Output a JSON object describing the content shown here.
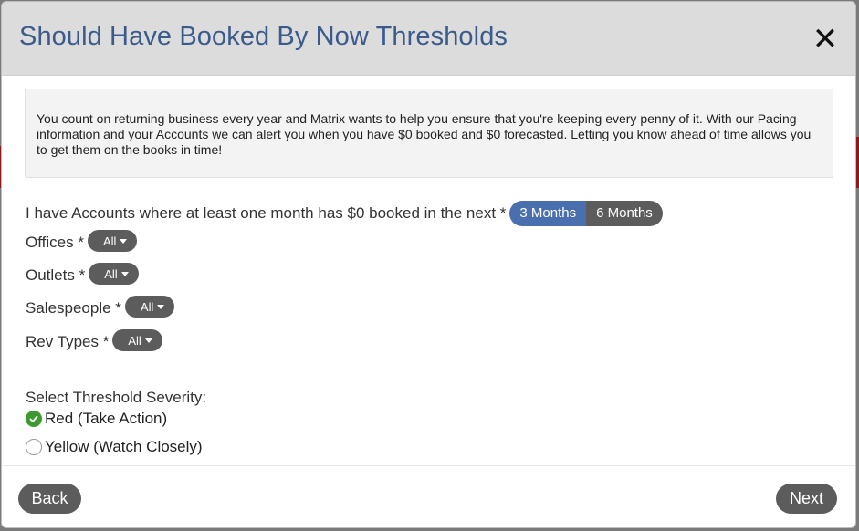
{
  "modal": {
    "title": "Should Have Booked By Now Thresholds",
    "close_label": "✕"
  },
  "info": {
    "text": "You count on returning business every year and Matrix wants to help you ensure that you're keeping every penny of it. With our Pacing information and your Accounts we can alert you when you have $0 booked and $0 forecasted. Letting you know ahead of time allows you to get them on the books in time!"
  },
  "months": {
    "label": "I have Accounts where at least one month has $0 booked in the next *",
    "options": [
      "3 Months",
      "6 Months"
    ],
    "selected": "3 Months"
  },
  "filters": {
    "offices": {
      "label": "Offices *",
      "value": "All"
    },
    "outlets": {
      "label": "Outlets *",
      "value": "All"
    },
    "salespeople": {
      "label": "Salespeople *",
      "value": "All"
    },
    "rev_types": {
      "label": "Rev Types *",
      "value": "All"
    }
  },
  "severity": {
    "label": "Select Threshold Severity:",
    "options": [
      {
        "label": "Red (Take Action)",
        "checked": true
      },
      {
        "label": "Yellow (Watch Closely)",
        "checked": false
      }
    ]
  },
  "footer": {
    "back_label": "Back",
    "next_label": "Next"
  },
  "colors": {
    "title": "#3b5b8c",
    "active_segment": "#4a6fae",
    "pill": "#5c5c5c",
    "checked_radio": "#3d9a2f"
  }
}
